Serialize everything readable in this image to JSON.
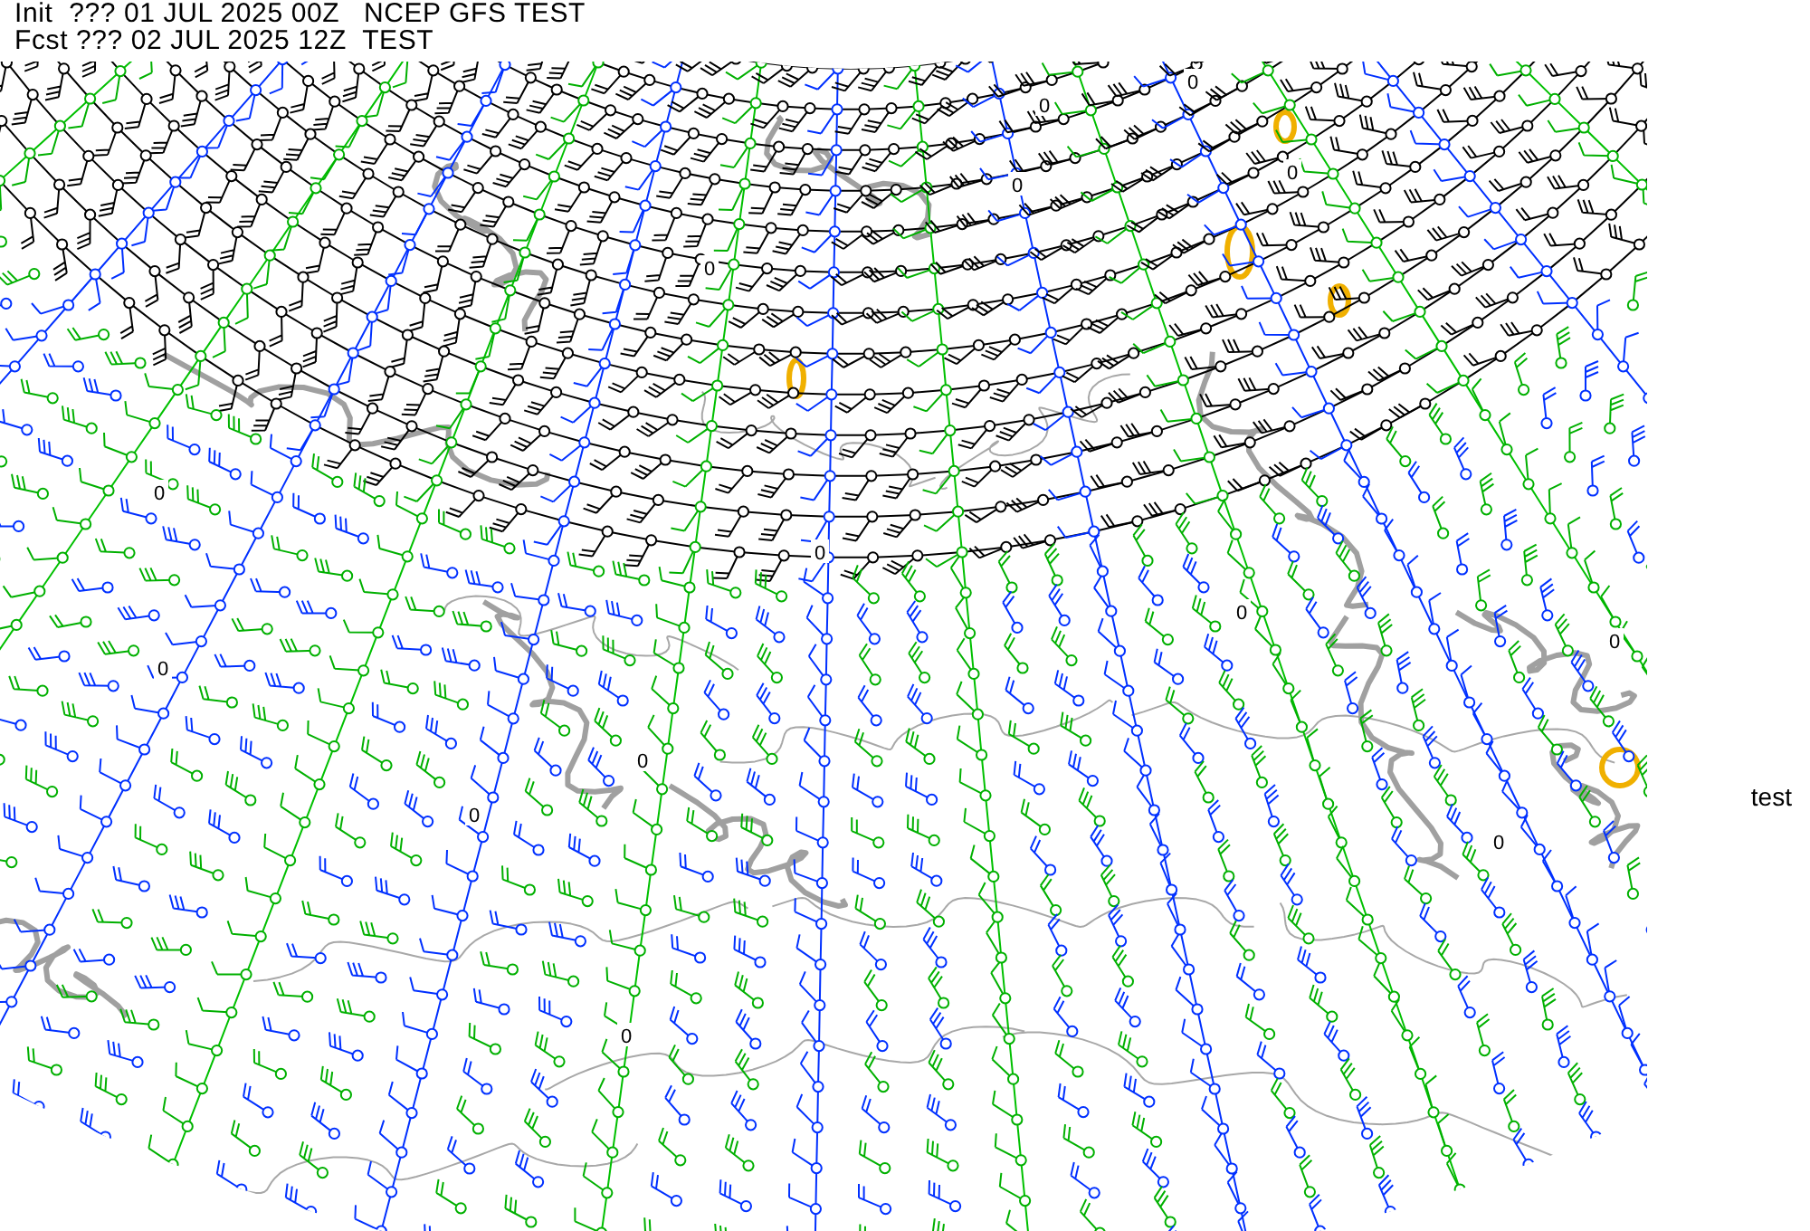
{
  "header": {
    "init_line": "Init  ??? 01 JUL 2025 00Z   NCEP GFS TEST",
    "forecast_line": "Fcst ??? 02 JUL 2025 12Z  TEST"
  },
  "map": {
    "contour_labels": [
      "0",
      "0",
      "0",
      "0",
      "0",
      "0",
      "0",
      "0",
      "0",
      "0",
      "0",
      "0",
      "0",
      "0"
    ]
  },
  "side_label": "test"
}
